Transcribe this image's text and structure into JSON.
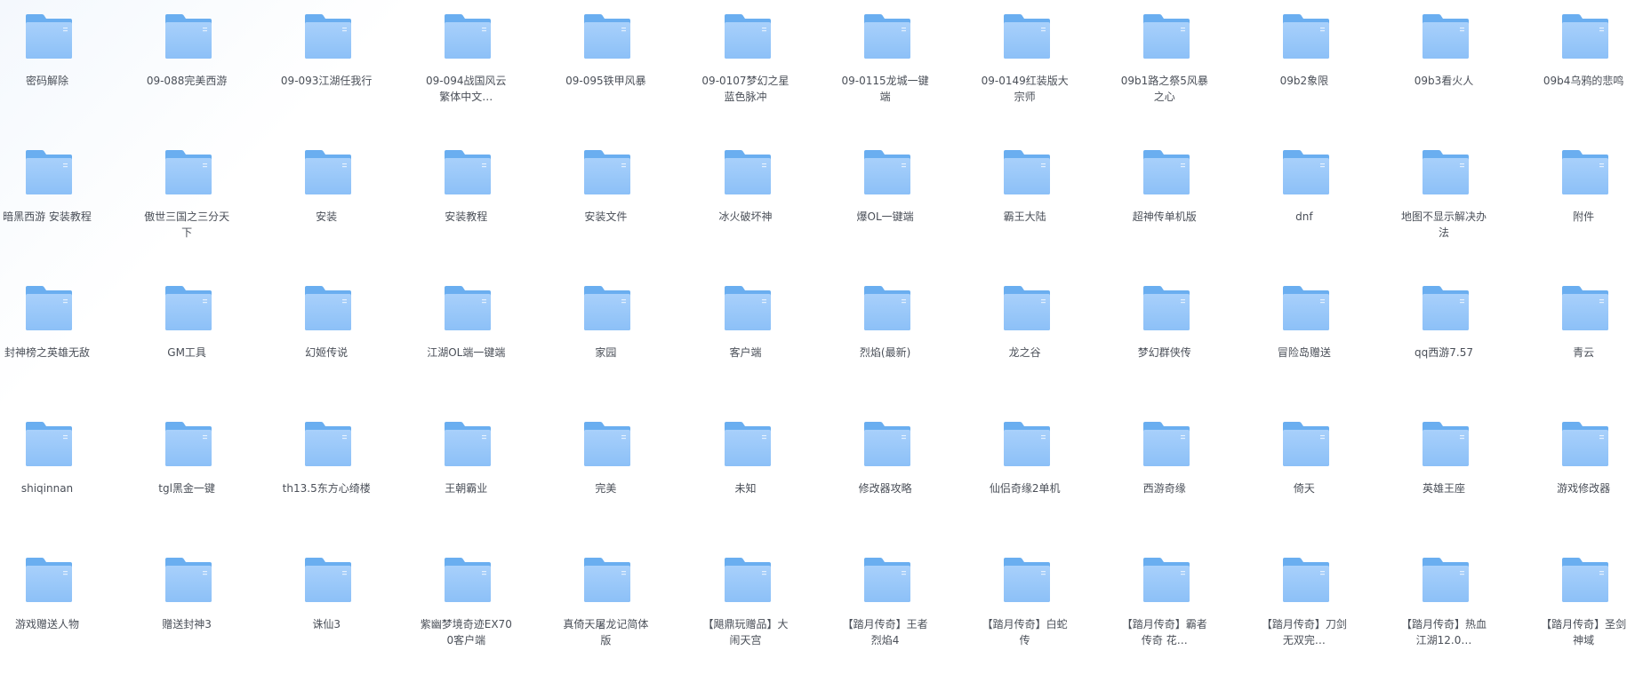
{
  "colors": {
    "folder_back": "#6aaef0",
    "folder_front": "#a8d0fb",
    "folder_front_bottom": "#8cc0f7",
    "label": "#4a4f58"
  },
  "icon": "folder-icon",
  "folders": [
    "密码解除",
    "09-088完美西游",
    "09-093江湖任我行",
    "09-094战国风云 繁体中文…",
    "09-095铁甲风暴",
    "09-0107梦幻之星蓝色脉冲",
    "09-0115龙城一键端",
    "09-0149红装版大宗师",
    "09b1路之祭5风暴之心",
    "09b2象限",
    "09b3看火人",
    "09b4乌鸦的悲鸣",
    "暗黑西游 安装教程",
    "傲世三国之三分天下",
    "安装",
    "安装教程",
    "安装文件",
    "冰火破坏神",
    "爆OL一键端",
    "霸王大陆",
    "超神传单机版",
    "dnf",
    "地图不显示解决办法",
    "附件",
    "封神榜之英雄无敌",
    "GM工具",
    "幻姬传说",
    "江湖OL端一键端",
    "家园",
    "客户端",
    "烈焰(最新)",
    "龙之谷",
    "梦幻群侠传",
    "冒险岛赠送",
    "qq西游7.57",
    "青云",
    "shiqinnan",
    "tgl黑金一键",
    "th13.5东方心绮楼",
    "王朝霸业",
    "完美",
    "未知",
    "修改器攻略",
    "仙侣奇缘2单机",
    "西游奇缘",
    "倚天",
    "英雄王座",
    "游戏修改器",
    "游戏赠送人物",
    "赠送封神3",
    "诛仙3",
    "紫幽梦境奇迹EX700客户端",
    "真倚天屠龙记简体版",
    "【飓鼎玩赠品】大闹天宫",
    "【踏月传奇】王者烈焰4",
    "【踏月传奇】白蛇传",
    "【踏月传奇】霸者传奇 花…",
    "【踏月传奇】刀剑无双完…",
    "【踏月传奇】热血江湖12.0…",
    "【踏月传奇】圣剑神域"
  ]
}
